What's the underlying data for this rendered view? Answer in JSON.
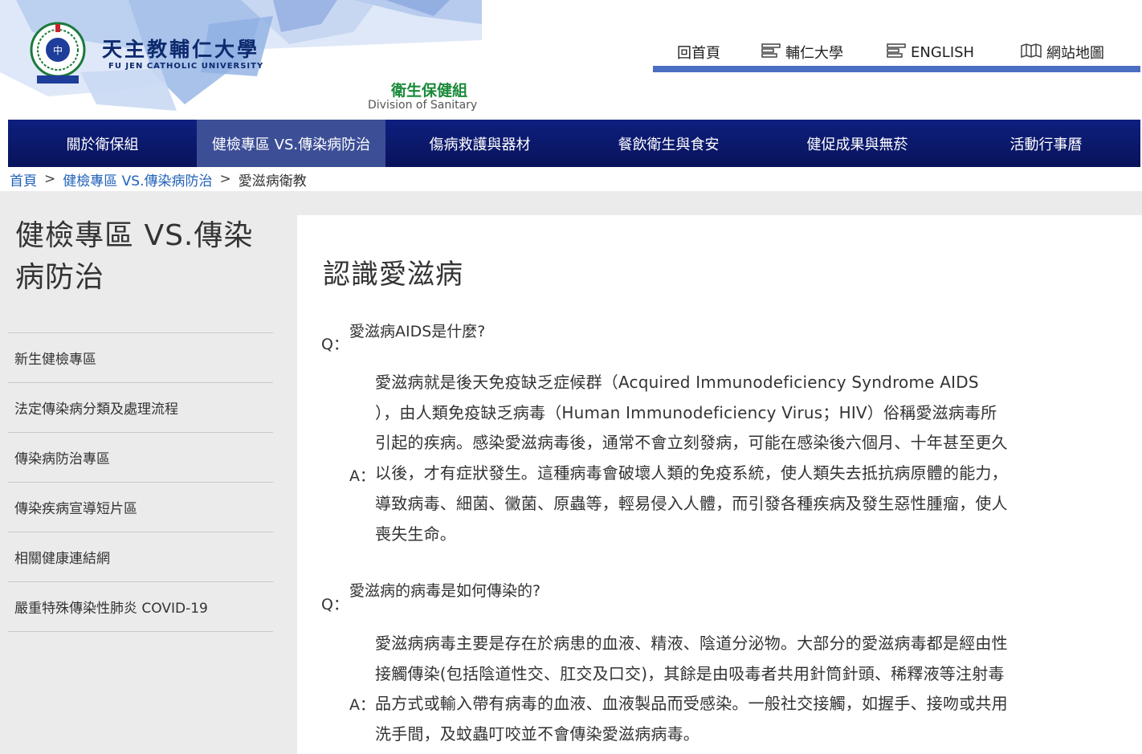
{
  "header": {
    "univ_name_zh": "天主教輔仁大學",
    "univ_name_en": "FU JEN CATHOLIC UNIVERSITY",
    "division_zh": "衛生保健組",
    "division_en": "Division of Sanitary",
    "top_links": [
      {
        "label": "回首頁",
        "icon": "none"
      },
      {
        "label": "輔仁大學",
        "icon": "list-icon"
      },
      {
        "label": "ENGLISH",
        "icon": "list-icon"
      },
      {
        "label": "網站地圖",
        "icon": "sitemap-icon"
      }
    ],
    "accent_color": "#4b6ec1"
  },
  "nav": {
    "items": [
      {
        "label": "關於衛保組"
      },
      {
        "label": "健檢專區 VS.傳染病防治",
        "active": true
      },
      {
        "label": "傷病救護與器材"
      },
      {
        "label": "餐飲衛生與食安"
      },
      {
        "label": "健促成果與無菸"
      },
      {
        "label": "活動行事曆"
      }
    ],
    "bg_color": "#0b1869"
  },
  "breadcrumb": {
    "items": [
      "首頁",
      "健檢專區 VS.傳染病防治",
      "愛滋病衛教"
    ],
    "separator": ">"
  },
  "sidebar": {
    "title_line1": "健檢專區 VS.傳染",
    "title_line2": "病防治",
    "items": [
      "新生健檢專區",
      "法定傳染病分類及處理流程",
      "傳染病防治專區",
      "傳染疾病宣導短片區",
      "相關健康連結網",
      "嚴重特殊傳染性肺炎 COVID-19"
    ]
  },
  "content": {
    "title": "認識愛滋病",
    "q_label": "Q：",
    "a_label": "A：",
    "qa": [
      {
        "question": "愛滋病AIDS是什麼?",
        "answer_lines": [
          "愛滋病就是後天免疫缺乏症候群（Acquired Immunodeficiency Syndrome AIDS",
          "），由人類免疫缺乏病毒（Human Immunodeficiency Virus；HIV）俗稱愛滋病毒所",
          "引起的疾病。感染愛滋病毒後，通常不會立刻發病，可能在感染後六個月、十年甚至更久",
          "以後，才有症狀發生。這種病毒會破壞人類的免疫系統，使人類失去抵抗病原體的能力，",
          "導致病毒、細菌、黴菌、原蟲等，輕易侵入人體，而引發各種疾病及發生惡性腫瘤，使人",
          "喪失生命。"
        ]
      },
      {
        "question": "愛滋病的病毒是如何傳染的?",
        "answer_lines": [
          "愛滋病病毒主要是存在於病患的血液、精液、陰道分泌物。大部分的愛滋病毒都是經由性",
          "接觸傳染(包括陰道性交、肛交及口交)，其餘是由吸毒者共用針筒針頭、稀釋液等注射毒",
          "品方式或輸入帶有病毒的血液、血液製品而受感染。一般社交接觸，如握手、接吻或共用",
          "洗手間，及蚊蟲叮咬並不會傳染愛滋病病毒。"
        ]
      }
    ]
  }
}
